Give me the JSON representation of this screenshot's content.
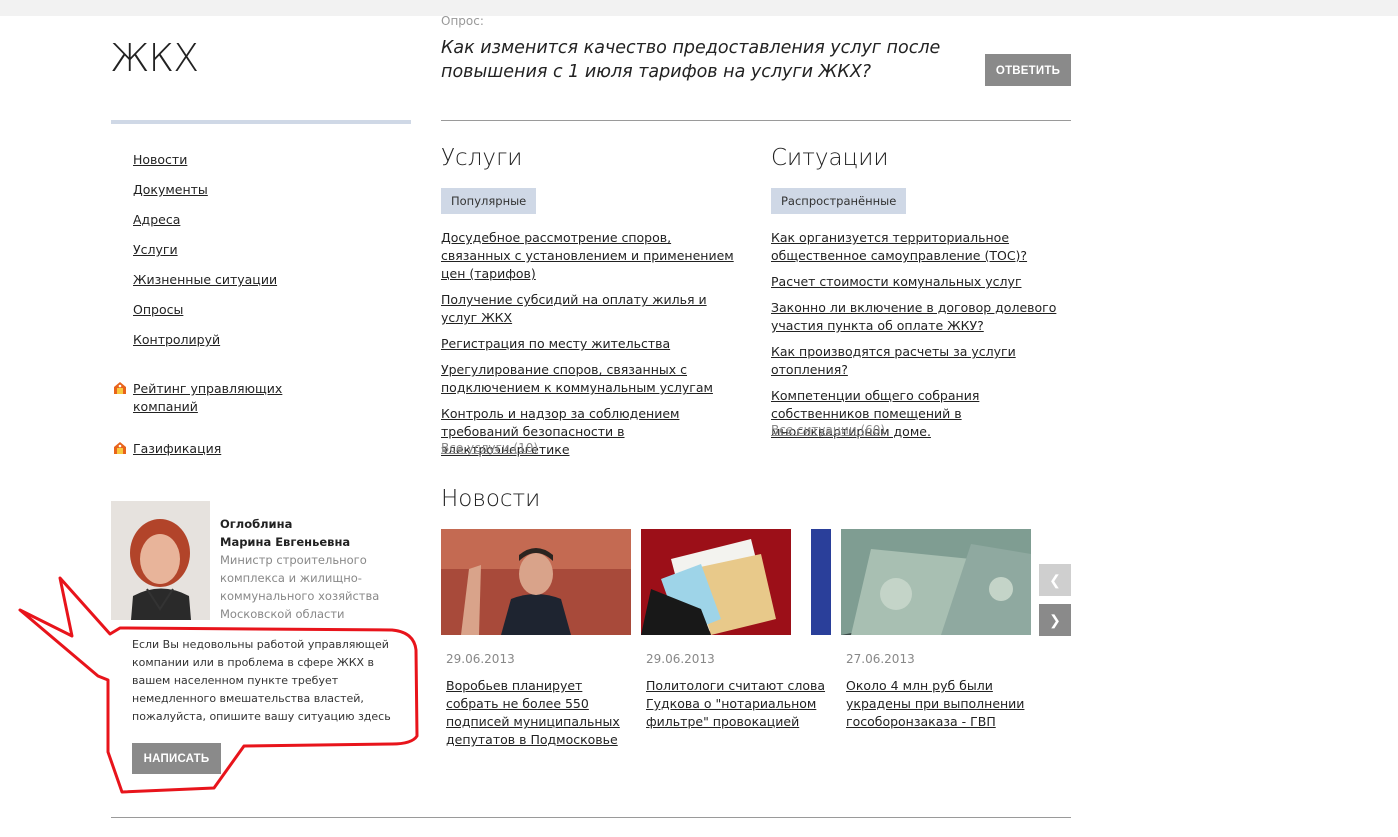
{
  "page": {
    "title": "ЖКХ"
  },
  "nav": {
    "items": [
      {
        "label": "Новости"
      },
      {
        "label": "Документы"
      },
      {
        "label": "Адреса"
      },
      {
        "label": "Услуги"
      },
      {
        "label": "Жизненные ситуации"
      },
      {
        "label": "Опросы"
      },
      {
        "label": "Контролируй"
      }
    ],
    "rating_label": "Рейтинг управляющих компаний",
    "gas_label": "Газификация"
  },
  "minister": {
    "name_line1": "Оглоблина",
    "name_line2": "Марина Евгеньевна",
    "role": "Министр строительного комплекса и жилищно-коммунального хозяйства Московской области"
  },
  "appeal": {
    "text": "Если Вы недовольны работой управляющей компании или в проблема в сфере ЖКХ в вашем населенном пункте требует немедленного вмешательства властей, пожалуйста, опишите вашу ситуацию здесь",
    "button_label": "НАПИСАТЬ"
  },
  "poll": {
    "label": "Опрос:",
    "question": "Как изменится качество предоставления услуг после повышения с 1 июля тарифов на услуги ЖКХ?",
    "button_label": "ОТВЕТИТЬ"
  },
  "services": {
    "heading": "Услуги",
    "tag": "Популярные",
    "items": [
      {
        "label": "Досудебное рассмотрение споров, связанных с установлением и применением цен (тарифов)"
      },
      {
        "label": "Получение субсидий на оплату жилья и услуг ЖКХ"
      },
      {
        "label": "Регистрация по месту жительства"
      },
      {
        "label": "Урегулирование споров, связанных с подключением к коммунальным услугам"
      },
      {
        "label": "Контроль и надзор за соблюдением требований безопасности в электроэнергетике"
      }
    ],
    "all_label": "Все услуги (10)"
  },
  "situations": {
    "heading": "Ситуации",
    "tag": "Распространённые",
    "items": [
      {
        "label": "Как организуется территориальное общественное самоуправление (ТОС)?"
      },
      {
        "label": "Расчет стоимости комунальных услуг"
      },
      {
        "label": "Законно ли включение в договор долевого участия пункта об оплате ЖКУ?"
      },
      {
        "label": "Как производятся расчеты за услуги отопления?"
      },
      {
        "label": "Компетенции общего собрания собственников помещений в многоквартирном доме."
      }
    ],
    "all_label": "Все ситуации (60)"
  },
  "news": {
    "heading": "Новости",
    "items": [
      {
        "date": "29.06.2013",
        "title": "Воробьев планирует собрать не более 550 подписей муниципальных депутатов в Подмосковье"
      },
      {
        "date": "29.06.2013",
        "title": "Политологи считают слова Гудкова о \"нотариальном фильтре\" провокацией"
      },
      {
        "date": "27.06.2013",
        "title": "Около 4 млн руб были украдены при выполнении гособоронзаказа - ГВП"
      }
    ]
  },
  "colors": {
    "accent_bg": "#cfd8e6",
    "button_gray": "#8a8a8a",
    "annotation_red": "#e8141b"
  }
}
